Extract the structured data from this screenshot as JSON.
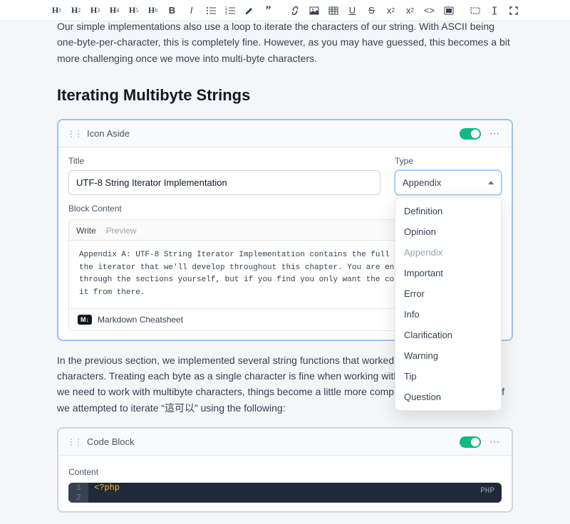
{
  "toolbar": {
    "headings": [
      "1",
      "2",
      "3",
      "4",
      "5",
      "6"
    ]
  },
  "paragraphs": {
    "top": "Our simple implementations also use a loop to iterate the characters of our string. With ASCII being one-byte-per-character, this is completely fine. However, as you may have guessed, this becomes a bit more challenging once we move into multi-byte characters.",
    "middle": "In the previous section, we implemented several string functions that worked by iterating a string's characters. Treating each byte as a single character is fine when working with ASCII, but as soon as we need to work with multibyte characters, things become a little more complicated. As an example, if we attempted to iterate “這可以” using the following:"
  },
  "heading": "Iterating Multibyte Strings",
  "icon_aside": {
    "label": "Icon Aside",
    "title_label": "Title",
    "title_value": "UTF-8 String Iterator Implementation",
    "type_label": "Type",
    "type_value": "Appendix",
    "dropdown_options": [
      "Definition",
      "Opinion",
      "Appendix",
      "Important",
      "Error",
      "Info",
      "Clarification",
      "Warning",
      "Tip",
      "Question"
    ],
    "content_label": "Block Content",
    "tabs": {
      "write": "Write",
      "preview": "Preview"
    },
    "content_text": "Appendix A: UTF-8 String Iterator Implementation contains the full implementation of the iterator that we'll develop throughout this chapter. You are encouraged to work through the sections yourself, but if you find you only want the code feel free to grab it from there.",
    "md_badge": "M↓",
    "md_link": "Markdown Cheatsheet"
  },
  "code_block": {
    "label": "Code Block",
    "content_label": "Content",
    "language": "PHP",
    "lines": [
      {
        "no": "1",
        "code": "<?php"
      },
      {
        "no": "2",
        "code": ""
      }
    ]
  }
}
